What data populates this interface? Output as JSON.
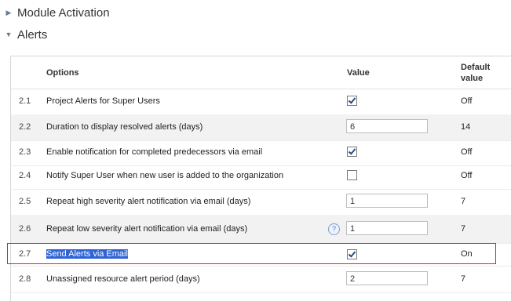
{
  "sections": {
    "module_activation": "Module Activation",
    "alerts": "Alerts"
  },
  "table": {
    "headers": {
      "options": "Options",
      "value": "Value",
      "default_line1": "Default",
      "default_line2": "value"
    },
    "rows": [
      {
        "num": "2.1",
        "option": "Project Alerts for Super Users",
        "type": "checkbox",
        "checked": true,
        "default": "Off"
      },
      {
        "num": "2.2",
        "option": "Duration to display resolved alerts (days)",
        "type": "input",
        "value": "6",
        "default": "14"
      },
      {
        "num": "2.3",
        "option": "Enable notification for completed predecessors via email",
        "type": "checkbox",
        "checked": true,
        "default": "Off"
      },
      {
        "num": "2.4",
        "option": "Notify Super User when new user is added to the organization",
        "type": "checkbox",
        "checked": false,
        "default": "Off"
      },
      {
        "num": "2.5",
        "option": "Repeat high severity alert notification via email (days)",
        "type": "input",
        "value": "1",
        "default": "7"
      },
      {
        "num": "2.6",
        "option": "Repeat low severity alert notification via email (days)",
        "type": "input",
        "value": "1",
        "default": "7",
        "help": "?"
      },
      {
        "num": "2.7",
        "option": "Send Alerts via Email",
        "type": "checkbox",
        "checked": true,
        "default": "On"
      },
      {
        "num": "2.8",
        "option": "Unassigned resource alert period (days)",
        "type": "input",
        "value": "2",
        "default": "7"
      }
    ]
  }
}
